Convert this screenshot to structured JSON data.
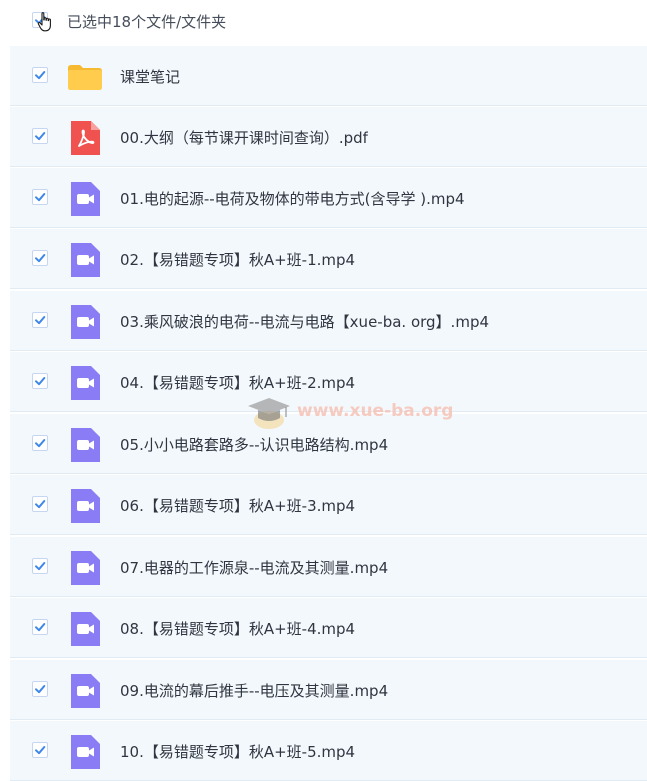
{
  "header": {
    "label": "已选中18个文件/文件夹",
    "select_all_checked": true
  },
  "files": [
    {
      "name": "课堂笔记",
      "type": "folder-icon",
      "checked": true
    },
    {
      "name": "00.大纲（每节课开课时间查询）.pdf",
      "type": "pdf-icon",
      "checked": true
    },
    {
      "name": "01.电的起源--电荷及物体的带电方式(含导学 ).mp4",
      "type": "video-icon",
      "checked": true
    },
    {
      "name": "02.【易错题专项】秋A+班-1.mp4",
      "type": "video-icon",
      "checked": true
    },
    {
      "name": "03.乘风破浪的电荷--电流与电路【xue-ba. org】.mp4",
      "type": "video-icon",
      "checked": true
    },
    {
      "name": "04.【易错题专项】秋A+班-2.mp4",
      "type": "video-icon",
      "checked": true
    },
    {
      "name": "05.小小电路套路多--认识电路结构.mp4",
      "type": "video-icon",
      "checked": true
    },
    {
      "name": "06.【易错题专项】秋A+班-3.mp4",
      "type": "video-icon",
      "checked": true
    },
    {
      "name": "07.电器的工作源泉--电流及其测量.mp4",
      "type": "video-icon",
      "checked": true
    },
    {
      "name": "08.【易错题专项】秋A+班-4.mp4",
      "type": "video-icon",
      "checked": true
    },
    {
      "name": "09.电流的幕后推手--电压及其测量.mp4",
      "type": "video-icon",
      "checked": true
    },
    {
      "name": "10.【易错题专项】秋A+班-5.mp4",
      "type": "video-icon",
      "checked": true
    }
  ],
  "watermark": {
    "text": "www.xue-ba.org"
  },
  "colors": {
    "check": "#3d87e8",
    "folder": "#ffcc4d",
    "pdf": "#f0524f",
    "video": "#8a7cf4",
    "row_bg": "#f3f8fc"
  }
}
